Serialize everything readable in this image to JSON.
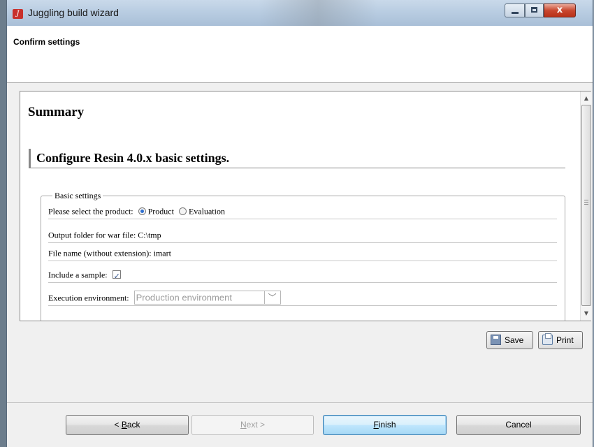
{
  "window": {
    "title": "Juggling build wizard",
    "close_glyph": "x"
  },
  "header": {
    "title": "Confirm settings"
  },
  "content": {
    "summary_heading": "Summary",
    "section_heading": "Configure Resin 4.0.x basic settings.",
    "basic_settings": {
      "legend": "Basic settings",
      "product_label": "Please select the product:",
      "product_options": [
        "Product",
        "Evaluation"
      ],
      "product_selected": "Product",
      "output_folder_text": "Output folder for war file: C:\\tmp",
      "file_name_text": "File name (without extension): imart",
      "include_sample_label": "Include a sample:",
      "include_sample_checked": true,
      "execution_env_label": "Execution environment:",
      "execution_env_value": "Production environment"
    }
  },
  "actions": {
    "save_label": "Save",
    "print_label": "Print"
  },
  "navigation": {
    "back_prefix": "< ",
    "back_mnemonic": "B",
    "back_rest": "ack",
    "next_mnemonic": "N",
    "next_rest": "ext >",
    "finish_mnemonic": "F",
    "finish_rest": "inish",
    "cancel_label": "Cancel"
  },
  "icons": {
    "app": "app-icon",
    "save": "floppy-disk-icon",
    "print": "printer-icon",
    "dropdown": "chevron-down-icon"
  },
  "colors": {
    "accent_radio": "#2f6fd0",
    "default_button_border": "#3c7fb1",
    "close_button": "#c9472f"
  }
}
